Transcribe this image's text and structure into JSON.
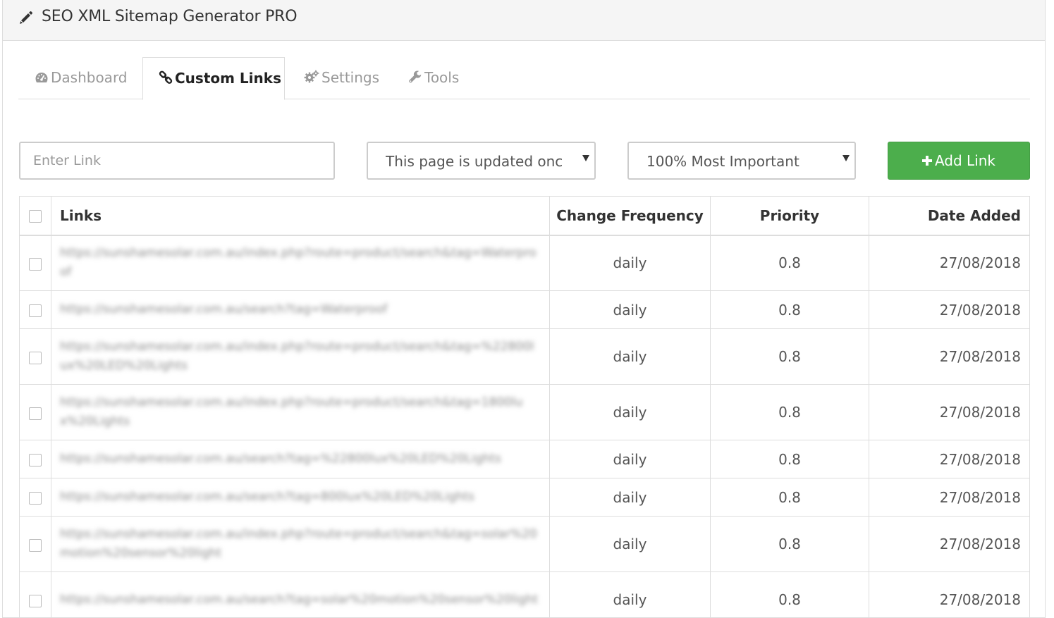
{
  "header": {
    "title": "SEO XML Sitemap Generator PRO",
    "icon": "pencil-icon"
  },
  "tabs": [
    {
      "label": "Dashboard",
      "icon": "dashboard-icon"
    },
    {
      "label": "Custom Links",
      "icon": "link-icon",
      "active": true
    },
    {
      "label": "Settings",
      "icon": "gears-icon"
    },
    {
      "label": "Tools",
      "icon": "wrench-icon"
    }
  ],
  "form": {
    "link_placeholder": "Enter Link",
    "frequency_value": "This page is updated once in a day",
    "priority_value": "100% Most Important",
    "add_button_label": "Add Link"
  },
  "colors": {
    "accent_green": "#4cae4c"
  },
  "table": {
    "headers": {
      "links": "Links",
      "frequency": "Change Frequency",
      "priority": "Priority",
      "date": "Date Added"
    },
    "rows": [
      {
        "link": "https://sunshamesolar.com.au/index.php?route=product/search&tag=Waterproof",
        "frequency": "daily",
        "priority": "0.8",
        "date": "27/08/2018"
      },
      {
        "link": "https://sunshamesolar.com.au/search?tag=Waterproof",
        "frequency": "daily",
        "priority": "0.8",
        "date": "27/08/2018"
      },
      {
        "link": "https://sunshamesolar.com.au/index.php?route=product/search&tag=%22800lux%20LED%20Lights",
        "frequency": "daily",
        "priority": "0.8",
        "date": "27/08/2018"
      },
      {
        "link": "https://sunshamesolar.com.au/index.php?route=product/search&tag=1800lux%20Lights",
        "frequency": "daily",
        "priority": "0.8",
        "date": "27/08/2018"
      },
      {
        "link": "https://sunshamesolar.com.au/search?tag=%22800lux%20LED%20Lights",
        "frequency": "daily",
        "priority": "0.8",
        "date": "27/08/2018"
      },
      {
        "link": "https://sunshamesolar.com.au/search?tag=800lux%20LED%20Lights",
        "frequency": "daily",
        "priority": "0.8",
        "date": "27/08/2018"
      },
      {
        "link": "https://sunshamesolar.com.au/index.php?route=product/search&tag=solar%20motion%20sensor%20light",
        "frequency": "daily",
        "priority": "0.8",
        "date": "27/08/2018"
      },
      {
        "link": "https://sunshamesolar.com.au/search?tag=solar%20motion%20sensor%20light",
        "frequency": "daily",
        "priority": "0.8",
        "date": "27/08/2018"
      }
    ]
  }
}
